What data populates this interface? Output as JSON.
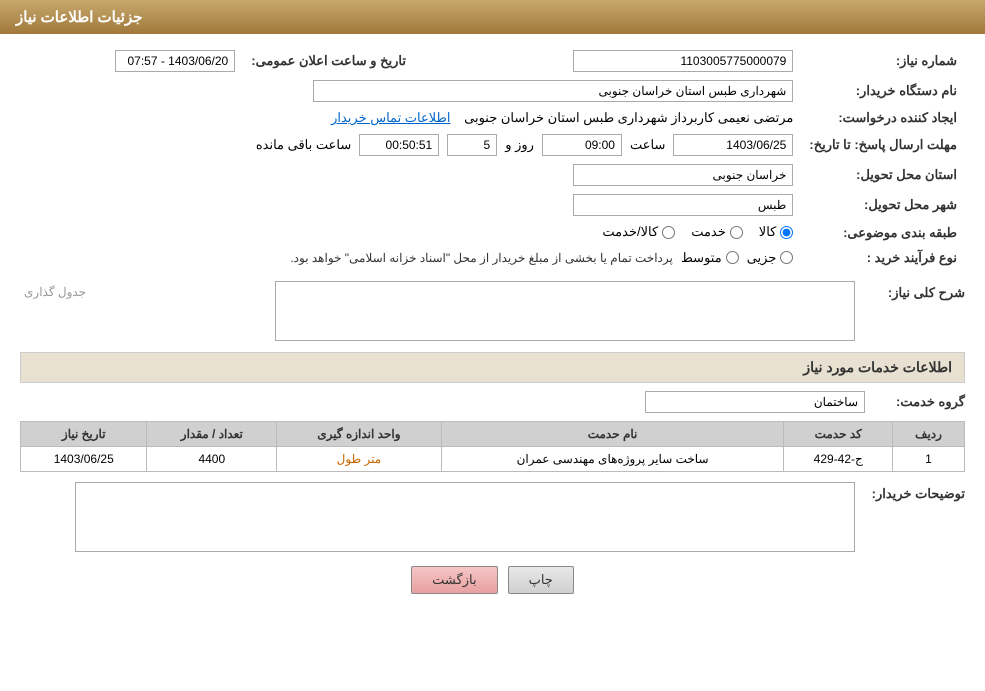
{
  "header": {
    "title": "جزئیات اطلاعات نیاز"
  },
  "fields": {
    "need_number_label": "شماره نیاز:",
    "need_number_value": "1103005775000079",
    "buyer_org_label": "نام دستگاه خریدار:",
    "buyer_org_value": "شهرداری طبس استان خراسان جنوبی",
    "creator_label": "ایجاد کننده درخواست:",
    "creator_value": "مرتضی نعیمی کاربرداز شهرداری طبس استان خراسان جنوبی",
    "contact_link": "اطلاعات تماس خریدار",
    "announce_date_label": "تاریخ و ساعت اعلان عمومی:",
    "announce_date_value": "1403/06/20 - 07:57",
    "deadline_label": "مهلت ارسال پاسخ: تا تاریخ:",
    "deadline_date": "1403/06/25",
    "deadline_time_label": "ساعت",
    "deadline_time": "09:00",
    "deadline_days_label": "روز و",
    "deadline_days": "5",
    "deadline_remaining_label": "ساعت باقی مانده",
    "deadline_remaining": "00:50:51",
    "province_label": "استان محل تحویل:",
    "province_value": "خراسان جنوبی",
    "city_label": "شهر محل تحویل:",
    "city_value": "طبس",
    "category_label": "طبقه بندی موضوعی:",
    "category_options": [
      "کالا",
      "خدمت",
      "کالا/خدمت"
    ],
    "category_selected": "کالا",
    "purchase_type_label": "نوع فرآیند خرید :",
    "purchase_type_options": [
      "جزیی",
      "متوسط"
    ],
    "purchase_type_text": "پرداخت تمام یا بخشی از مبلغ خریدار از محل \"اسناد خزانه اسلامی\" خواهد بود.",
    "description_label": "شرح کلی نیاز:",
    "description_placeholder": "جدول گذاری",
    "services_section_label": "اطلاعات خدمات مورد نیاز",
    "service_group_label": "گروه خدمت:",
    "service_group_value": "ساختمان",
    "table_headers": [
      "ردیف",
      "کد حدمت",
      "نام حدمت",
      "واحد اندازه گیری",
      "تعداد / مقدار",
      "تاریخ نیاز"
    ],
    "table_rows": [
      {
        "row": "1",
        "code": "ج-42-429",
        "name": "ساخت سایر پروژه‌های مهندسی عمران",
        "unit": "متر طول",
        "quantity": "4400",
        "date": "1403/06/25"
      }
    ],
    "buyer_desc_label": "توضیحات خریدار:",
    "btn_print": "چاپ",
    "btn_back": "بازگشت"
  }
}
